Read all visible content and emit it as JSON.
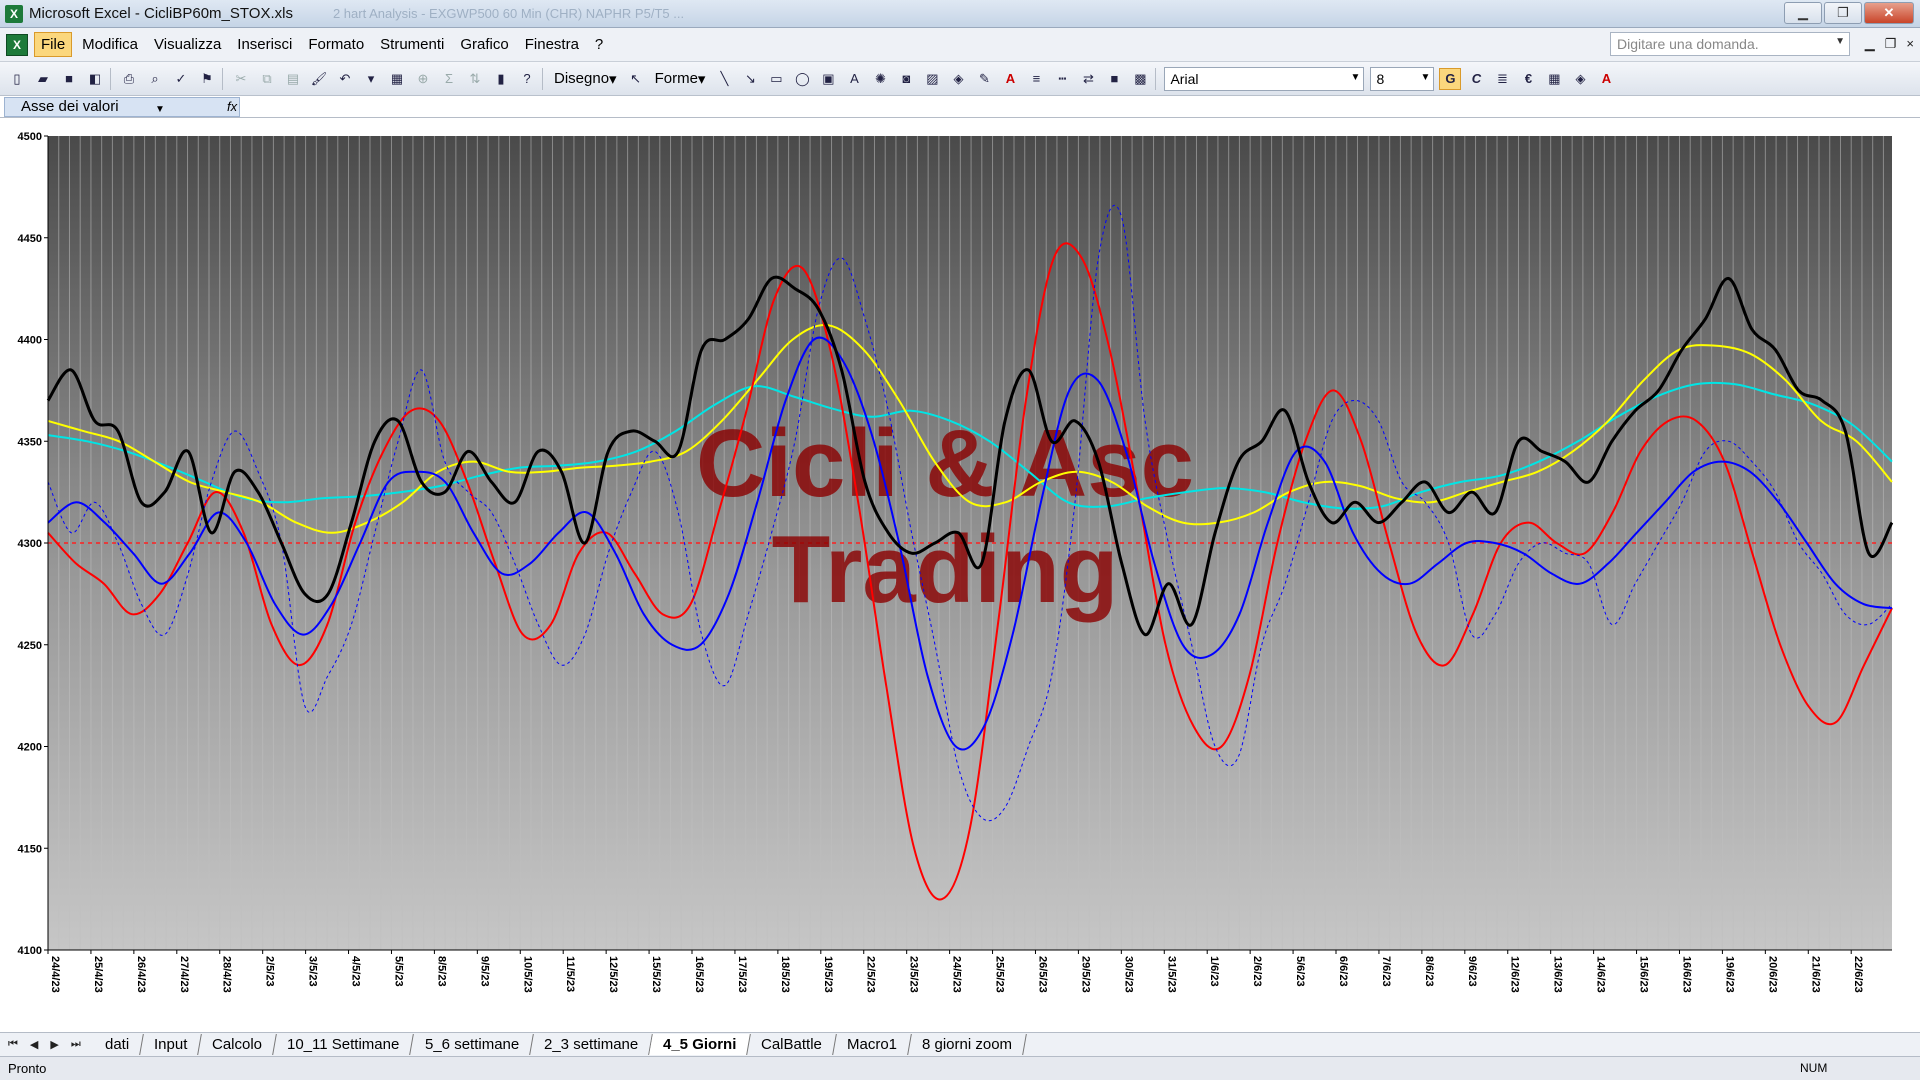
{
  "window": {
    "title": "Microsoft Excel - CicliBP60m_STOX.xls",
    "ghost_tabs": "2 hart Analysis - EXGWP500 60 Min (CHR) NAPHR P5/T5 ...",
    "app_badge": "X"
  },
  "menu": {
    "items": [
      "File",
      "Modifica",
      "Visualizza",
      "Inserisci",
      "Formato",
      "Strumenti",
      "Grafico",
      "Finestra",
      "?"
    ],
    "active": "File",
    "ask_placeholder": "Digitare una domanda.",
    "doc_close": "×"
  },
  "toolbar": {
    "draw_label": "Disegno",
    "shapes_label": "Forme",
    "font_name": "Arial",
    "font_size": "8",
    "bold": "G",
    "italic": "C",
    "euro": "€"
  },
  "formula": {
    "name_box": "Asse dei valori",
    "fx": "fx"
  },
  "chart_data": {
    "type": "line",
    "ylim": [
      4100,
      4500
    ],
    "yticks": [
      4100,
      4150,
      4200,
      4250,
      4300,
      4350,
      4400,
      4450,
      4500
    ],
    "reference_line": 4300,
    "x_labels": [
      "24/4/23",
      "25/4/23",
      "26/4/23",
      "27/4/23",
      "28/4/23",
      "2/5/23",
      "3/5/23",
      "4/5/23",
      "5/5/23",
      "8/5/23",
      "9/5/23",
      "10/5/23",
      "11/5/23",
      "12/5/23",
      "15/5/23",
      "16/5/23",
      "17/5/23",
      "18/5/23",
      "19/5/23",
      "22/5/23",
      "23/5/23",
      "24/5/23",
      "25/5/23",
      "26/5/23",
      "29/5/23",
      "30/5/23",
      "31/5/23",
      "1/6/23",
      "2/6/23",
      "5/6/23",
      "6/6/23",
      "7/6/23",
      "8/6/23",
      "9/6/23",
      "12/6/23",
      "13/6/23",
      "14/6/23",
      "15/6/23",
      "16/6/23",
      "19/6/23",
      "20/6/23",
      "21/6/23",
      "22/6/23"
    ],
    "watermark": [
      "Cicli & Asc",
      "Trading"
    ],
    "series": [
      {
        "color": "#000000",
        "width": 3,
        "dash": "",
        "values": [
          4370,
          4385,
          4360,
          4355,
          4320,
          4325,
          4345,
          4305,
          4335,
          4325,
          4300,
          4275,
          4275,
          4310,
          4350,
          4360,
          4330,
          4325,
          4345,
          4330,
          4320,
          4345,
          4335,
          4300,
          4345,
          4355,
          4350,
          4345,
          4395,
          4400,
          4410,
          4430,
          4425,
          4415,
          4385,
          4330,
          4305,
          4295,
          4300,
          4305,
          4290,
          4360,
          4385,
          4350,
          4360,
          4340,
          4290,
          4255,
          4280,
          4260,
          4305,
          4340,
          4350,
          4365,
          4330,
          4310,
          4320,
          4310,
          4320,
          4330,
          4315,
          4325,
          4315,
          4350,
          4345,
          4340,
          4330,
          4350,
          4365,
          4375,
          4395,
          4410,
          4430,
          4405,
          4395,
          4375,
          4370,
          4355,
          4295,
          4310
        ]
      },
      {
        "color": "#0000ff",
        "width": 1,
        "dash": "3,3",
        "values": [
          4330,
          4305,
          4320,
          4300,
          4270,
          4255,
          4285,
          4330,
          4355,
          4335,
          4300,
          4220,
          4235,
          4260,
          4305,
          4350,
          4385,
          4340,
          4325,
          4315,
          4290,
          4260,
          4240,
          4255,
          4295,
          4325,
          4345,
          4315,
          4255,
          4230,
          4265,
          4305,
          4350,
          4415,
          4440,
          4410,
          4365,
          4305,
          4250,
          4190,
          4165,
          4170,
          4200,
          4235,
          4320,
          4440,
          4460,
          4360,
          4300,
          4250,
          4200,
          4195,
          4250,
          4280,
          4320,
          4360,
          4370,
          4360,
          4330,
          4320,
          4300,
          4255,
          4265,
          4290,
          4300,
          4295,
          4290,
          4260,
          4280,
          4300,
          4320,
          4345,
          4350,
          4340,
          4325,
          4300,
          4285,
          4265,
          4260,
          4270
        ]
      },
      {
        "color": "#0000ff",
        "width": 2,
        "dash": "",
        "values": [
          4310,
          4320,
          4310,
          4295,
          4280,
          4295,
          4315,
          4300,
          4270,
          4255,
          4270,
          4300,
          4330,
          4335,
          4330,
          4305,
          4285,
          4290,
          4305,
          4315,
          4295,
          4265,
          4250,
          4250,
          4275,
          4320,
          4370,
          4400,
          4390,
          4355,
          4300,
          4235,
          4200,
          4210,
          4255,
          4320,
          4375,
          4380,
          4345,
          4290,
          4250,
          4245,
          4265,
          4310,
          4345,
          4340,
          4305,
          4285,
          4280,
          4290,
          4300,
          4300,
          4295,
          4285,
          4280,
          4290,
          4305,
          4320,
          4335,
          4340,
          4335,
          4320,
          4300,
          4280,
          4270,
          4268
        ]
      },
      {
        "color": "#ff0000",
        "width": 2,
        "dash": "",
        "values": [
          4305,
          4290,
          4280,
          4265,
          4275,
          4300,
          4325,
          4305,
          4260,
          4240,
          4260,
          4310,
          4345,
          4365,
          4360,
          4330,
          4290,
          4255,
          4260,
          4295,
          4305,
          4285,
          4265,
          4270,
          4315,
          4365,
          4420,
          4435,
          4395,
          4320,
          4230,
          4150,
          4125,
          4160,
          4260,
          4370,
          4440,
          4440,
          4395,
          4325,
          4250,
          4210,
          4200,
          4235,
          4300,
          4350,
          4375,
          4350,
          4300,
          4255,
          4240,
          4265,
          4300,
          4310,
          4300,
          4295,
          4315,
          4345,
          4360,
          4360,
          4340,
          4295,
          4250,
          4220,
          4212,
          4240,
          4268
        ]
      },
      {
        "color": "#ffff00",
        "width": 2,
        "dash": "",
        "values": [
          4360,
          4355,
          4350,
          4340,
          4330,
          4325,
          4320,
          4310,
          4305,
          4310,
          4320,
          4335,
          4340,
          4335,
          4335,
          4337,
          4338,
          4340,
          4345,
          4360,
          4380,
          4400,
          4407,
          4395,
          4370,
          4340,
          4320,
          4320,
          4330,
          4335,
          4330,
          4318,
          4310,
          4310,
          4315,
          4325,
          4330,
          4328,
          4322,
          4320,
          4325,
          4330,
          4335,
          4345,
          4360,
          4380,
          4395,
          4397,
          4393,
          4380,
          4360,
          4350,
          4330
        ]
      },
      {
        "color": "#00e5e5",
        "width": 2,
        "dash": "",
        "values": [
          4353,
          4350,
          4345,
          4338,
          4330,
          4322,
          4320,
          4322,
          4323,
          4325,
          4328,
          4333,
          4337,
          4338,
          4340,
          4345,
          4355,
          4368,
          4377,
          4372,
          4366,
          4362,
          4365,
          4360,
          4350,
          4335,
          4320,
          4318,
          4322,
          4325,
          4327,
          4325,
          4320,
          4317,
          4318,
          4325,
          4330,
          4333,
          4340,
          4350,
          4362,
          4372,
          4378,
          4378,
          4373,
          4368,
          4358,
          4340
        ]
      }
    ]
  },
  "sheets": [
    "dati",
    "Input",
    "Calcolo",
    "10_11 Settimane",
    "5_6 settimane",
    "2_3 settimane",
    "4_5 Giorni",
    "CalBattle",
    "Macro1",
    "8 giorni zoom"
  ],
  "active_sheet": "4_5 Giorni",
  "status": {
    "ready": "Pronto",
    "num": "NUM"
  }
}
